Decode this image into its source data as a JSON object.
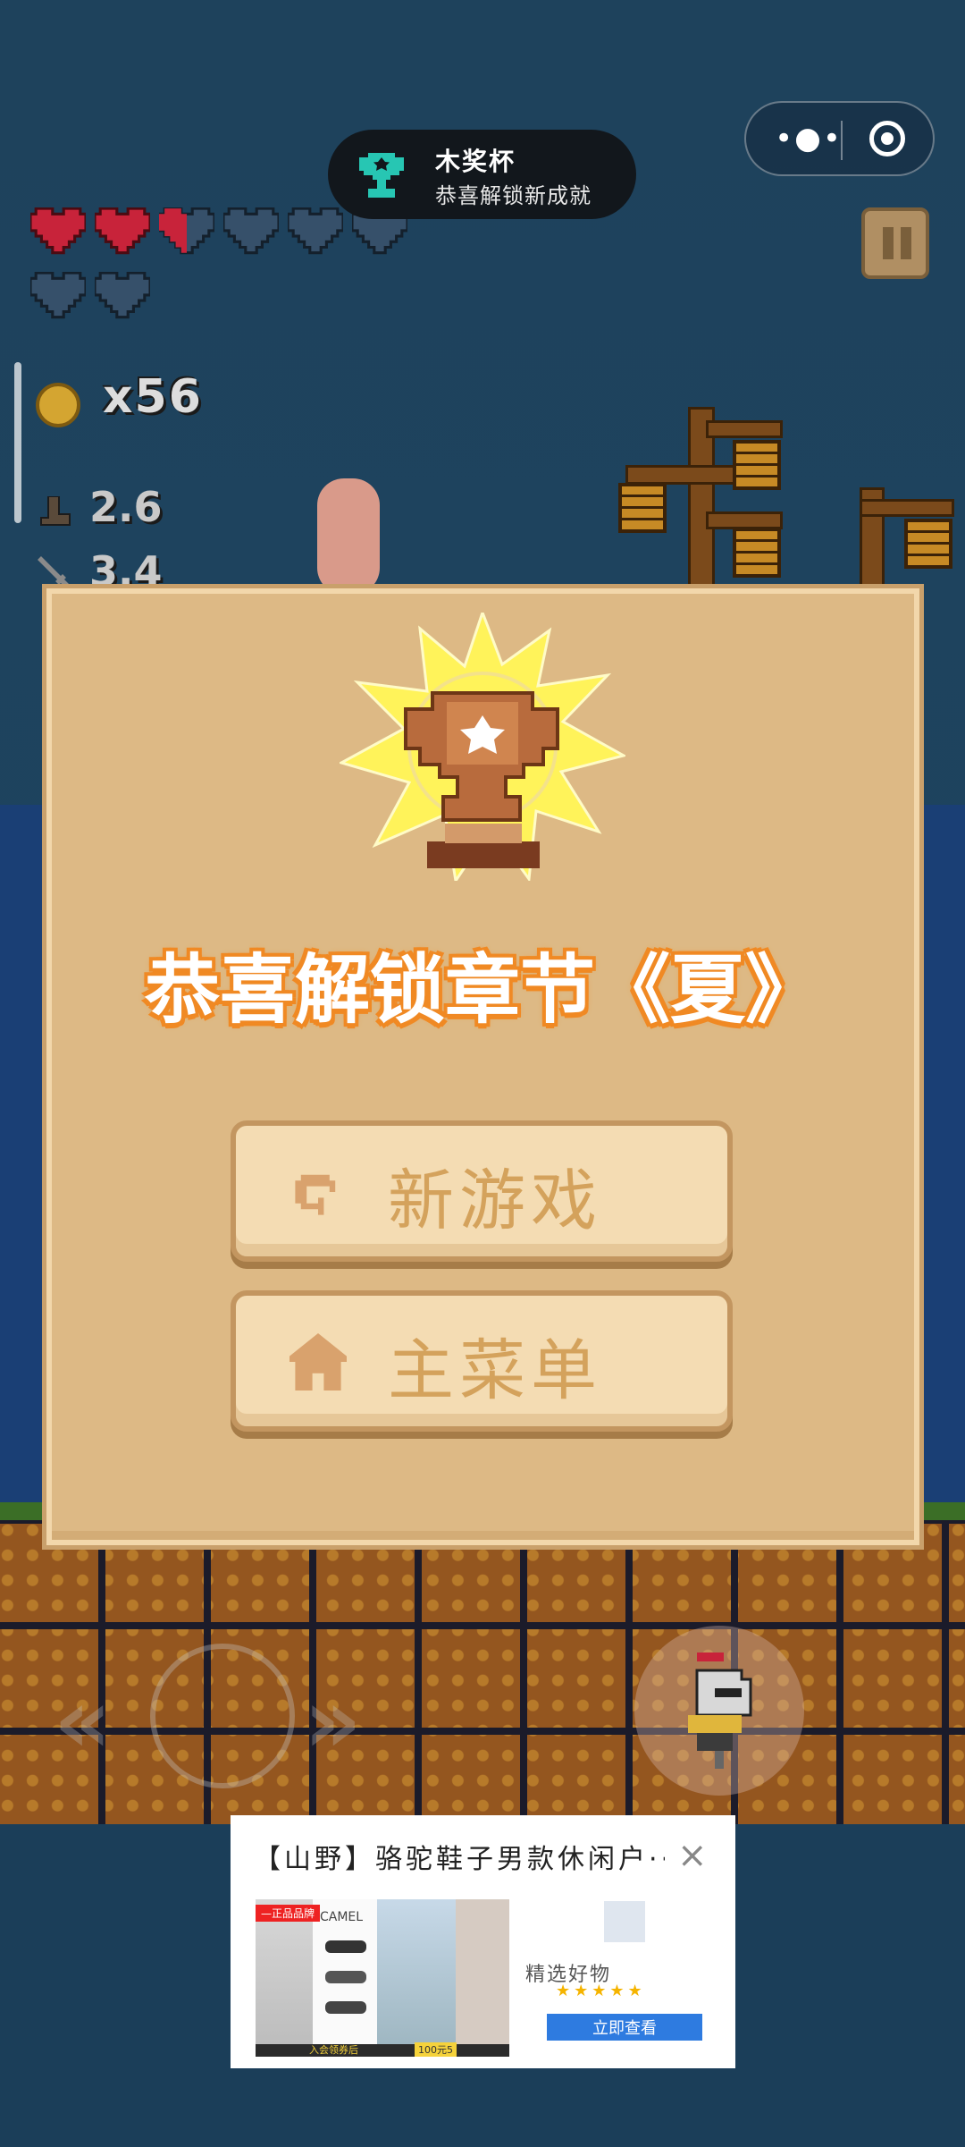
{
  "capsule": {
    "more_icon": "more-dots-icon",
    "close_icon": "target-icon"
  },
  "toast": {
    "title": "木奖杯",
    "subtitle": "恭喜解锁新成就",
    "icon": "trophy-icon",
    "accent": "#27c6b3"
  },
  "hud": {
    "hearts": {
      "full": 2,
      "half": 1,
      "empty": 5,
      "total": 8
    },
    "coin_label": "x56",
    "speed": "2.6",
    "attack": "3.4",
    "pause_icon": "pause-icon"
  },
  "modal": {
    "title": "恭喜解锁章节《夏》",
    "buttons": [
      {
        "label": "新游戏",
        "icon": "restart-icon"
      },
      {
        "label": "主菜单",
        "icon": "home-icon"
      }
    ],
    "colors": {
      "panel": "#ddb985",
      "button": "#f4dcb3",
      "text": "#d4a25c",
      "title_glow": "#f08a25"
    }
  },
  "controls": {
    "left": "«",
    "right": "»",
    "action_icon": "knight-icon"
  },
  "ad": {
    "title": "【山野】骆驼鞋子男款休闲户···",
    "close": "×",
    "badge": "—正品品牌",
    "brand": "CAMEL",
    "tagline": "精选好物",
    "promo": "入会领券后",
    "price": "100元5",
    "cta": "立即查看"
  }
}
